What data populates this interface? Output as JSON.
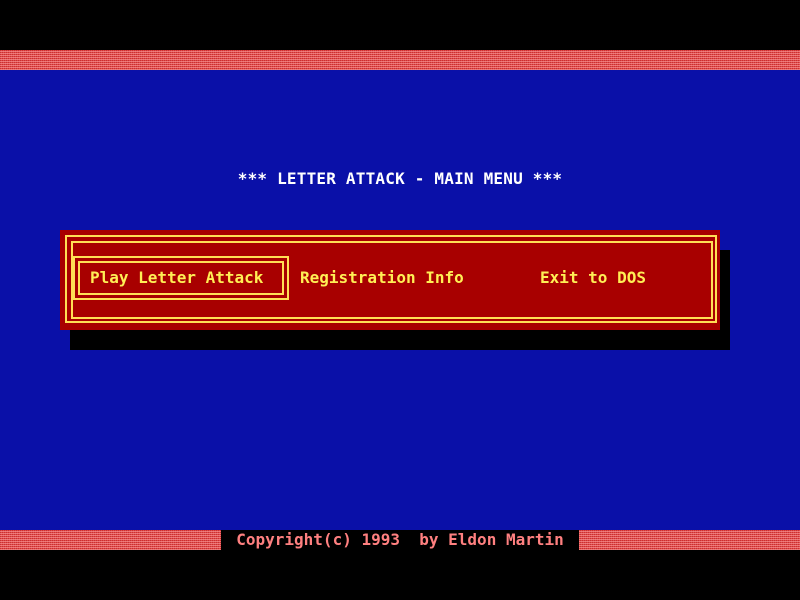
{
  "screen": {
    "title": "*** LETTER ATTACK - MAIN MENU ***",
    "colors": {
      "background": "#0a10a8",
      "panel": "#a80000",
      "border": "#ffdf55",
      "menu_text": "#ffef55",
      "title_text": "#ffffff",
      "copyright_text": "#ff8080",
      "hatch": "#e04848"
    }
  },
  "menu": {
    "selected_index": 0,
    "items": [
      {
        "label": "Play Letter Attack",
        "selected": true
      },
      {
        "label": "Registration Info",
        "selected": false
      },
      {
        "label": "Exit to DOS",
        "selected": false
      }
    ]
  },
  "footer": {
    "copyright": "Copyright(c) 1993  by Eldon Martin"
  }
}
